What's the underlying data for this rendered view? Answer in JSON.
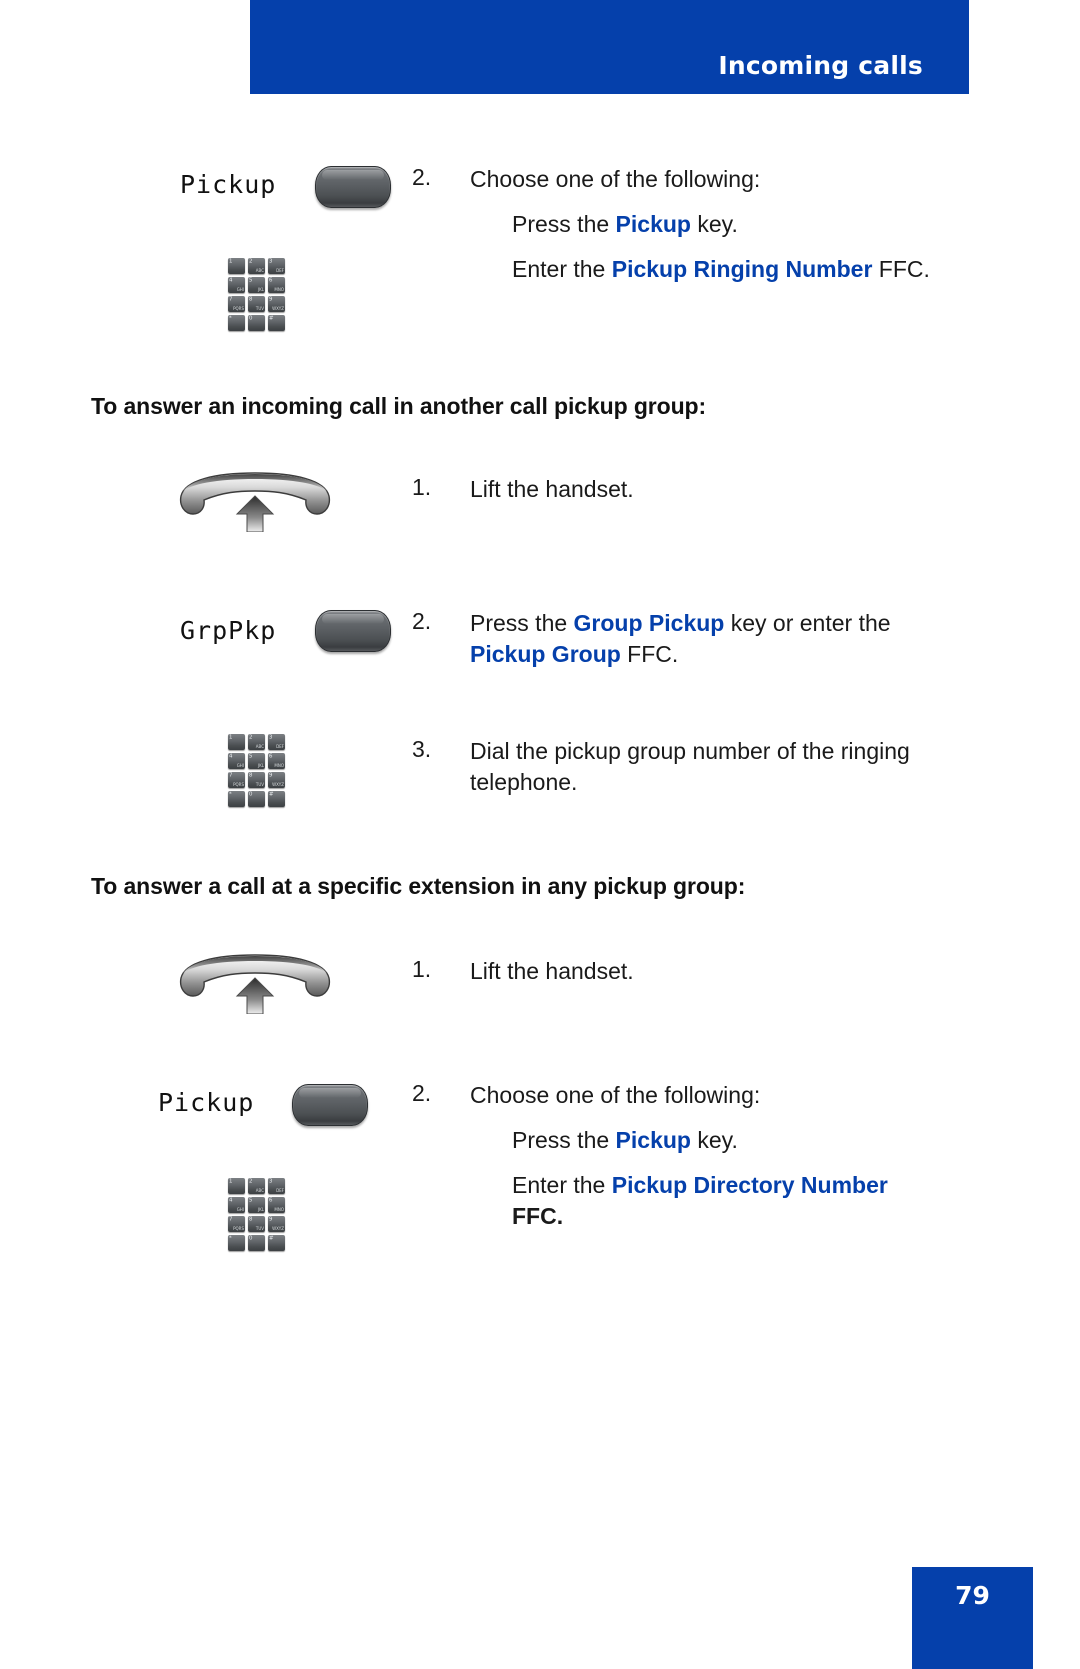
{
  "header": {
    "title": "Incoming calls",
    "banner_color": "#0540ab"
  },
  "footer": {
    "page_number": "79",
    "box_color": "#0540ab"
  },
  "colors": {
    "accent_blue": "#0540ab",
    "body_text": "#1a1a1a"
  },
  "keypad_keys": [
    {
      "digit": "1",
      "letters": ""
    },
    {
      "digit": "2",
      "letters": "ABC"
    },
    {
      "digit": "3",
      "letters": "DEF"
    },
    {
      "digit": "4",
      "letters": "GHI"
    },
    {
      "digit": "5",
      "letters": "JKL"
    },
    {
      "digit": "6",
      "letters": "MNO"
    },
    {
      "digit": "7",
      "letters": "PQRS"
    },
    {
      "digit": "8",
      "letters": "TUV"
    },
    {
      "digit": "9",
      "letters": "WXYZ"
    },
    {
      "digit": "*",
      "letters": ""
    },
    {
      "digit": "0",
      "letters": ""
    },
    {
      "digit": "#",
      "letters": ""
    }
  ],
  "section_a": {
    "step2": {
      "number": "2.",
      "text": "Choose one of the following:",
      "option1_prefix": "Press the ",
      "option1_key": "Pickup",
      "option1_suffix": " key.",
      "option2_prefix": "Enter the ",
      "option2_key": "Pickup Ringing Number",
      "option2_suffix": " FFC.",
      "softkey_label": "Pickup"
    }
  },
  "section_b": {
    "heading": "To answer an incoming call in another call pickup group:",
    "step1": {
      "number": "1.",
      "text": "Lift the handset."
    },
    "step2": {
      "number": "2.",
      "line1_prefix": "Press the ",
      "line1_key": "Group Pickup",
      "line1_mid": " key or enter the ",
      "line1_key2": "Pickup Group",
      "line1_suffix": " FFC.",
      "softkey_label": "GrpPkp"
    },
    "step3": {
      "number": "3.",
      "text": "Dial the pickup group number of the ringing telephone."
    }
  },
  "section_c": {
    "heading": "To answer a call at a specific extension in any pickup group:",
    "step1": {
      "number": "1.",
      "text": "Lift the handset."
    },
    "step2": {
      "number": "2.",
      "text": "Choose one of the following:",
      "option1_prefix": "Press the ",
      "option1_key": "Pickup",
      "option1_suffix": " key.",
      "option2_prefix": "Enter the ",
      "option2_key": "Pickup Directory Number",
      "option2_suffix": " FFC.",
      "softkey_label": "Pickup"
    }
  }
}
